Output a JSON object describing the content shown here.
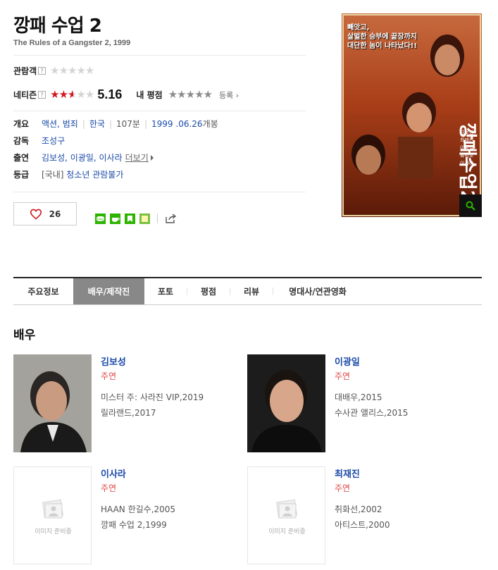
{
  "movie": {
    "title": "깡패 수업 2",
    "subtitle": "The Rules of a Gangster 2, 1999"
  },
  "ratings": {
    "audience_label": "관람객",
    "help_mark": "?",
    "netizen_label": "네티즌",
    "netizen_score": "5.16",
    "netizen_stars_fraction": 0.516,
    "my_rating_label": "내 평점",
    "register_label": "등록"
  },
  "info": {
    "overview_label": "개요",
    "genre1": "액션",
    "genre2": "범죄",
    "genre_sep": ",",
    "country": "한국",
    "runtime": "107분",
    "release_date": "1999 .06.26",
    "release_suffix": "개봉",
    "director_label": "감독",
    "director": "조성구",
    "cast_label": "출연",
    "cast": "김보성, 이광일, 이사라",
    "more_label": "더보기",
    "grade_label": "등급",
    "grade_prefix": "[국내]",
    "grade": "청소년 관람불가"
  },
  "like": {
    "count": "26"
  },
  "poster": {
    "headline_lines": [
      "빼앗고,",
      "살벌한 승부에 끝장까지",
      "대단한 놈이 나타났다!!"
    ],
    "title_art": "깡패수업2",
    "cast_lines": [
      "김보성",
      "최재진",
      "이광일",
      "류미오",
      "이사라"
    ]
  },
  "tabs": [
    {
      "label": "주요정보"
    },
    {
      "label": "배우/제작진"
    },
    {
      "label": "포토"
    },
    {
      "label": "평점"
    },
    {
      "label": "리뷰"
    },
    {
      "label": "명대사/연관영화"
    }
  ],
  "actors_section": {
    "title": "배우"
  },
  "actors": [
    {
      "name": "김보성",
      "role": "주연",
      "films": [
        "미스터 주: 사라진 VIP,2019",
        "릴라랜드,2017"
      ]
    },
    {
      "name": "이광일",
      "role": "주연",
      "films": [
        "대배우,2015",
        "수사관 앨리스,2015"
      ]
    },
    {
      "name": "이사라",
      "role": "주연",
      "films": [
        "HAAN 한길수,2005",
        "깡패 수업 2,1999"
      ]
    },
    {
      "name": "최재진",
      "role": "주연",
      "films": [
        "취화선,2002",
        "아티스트,2000"
      ]
    }
  ],
  "no_image_label": "이미지 준비중",
  "colors": {
    "accent_red": "#d2171f",
    "link_blue": "#1a4aa8",
    "active_tab": "#888888"
  }
}
